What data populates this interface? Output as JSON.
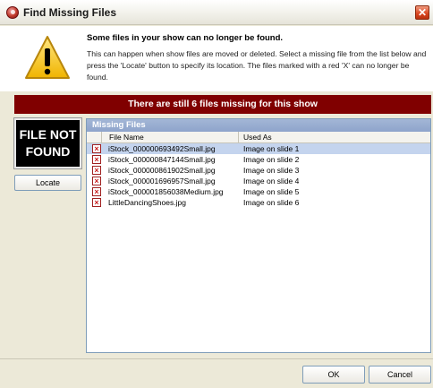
{
  "window": {
    "title": "Find Missing Files",
    "close_glyph": "✕"
  },
  "header": {
    "heading": "Some files in your show can no longer be found.",
    "body": "This can happen when show files are moved or deleted. Select a missing file from the list below and press the 'Locate' button to specify its location. The files marked with a red 'X' can no longer be found.",
    "icon": "warning-icon"
  },
  "banner": {
    "text": "There are still 6 files missing for this show",
    "color": "#800000"
  },
  "preview": {
    "line1": "FILE NOT",
    "line2": "FOUND"
  },
  "locate_button": "Locate",
  "missing_files": {
    "title": "Missing Files",
    "columns": [
      "File Name",
      "Used As"
    ],
    "rows": [
      {
        "file": "iStock_000000693492Small.jpg",
        "used_as": "Image on slide 1",
        "selected": true
      },
      {
        "file": "iStock_000000847144Small.jpg",
        "used_as": "Image on slide 2",
        "selected": false
      },
      {
        "file": "iStock_000000861902Small.jpg",
        "used_as": "Image on slide 3",
        "selected": false
      },
      {
        "file": "iStock_000001696957Small.jpg",
        "used_as": "Image on slide 4",
        "selected": false
      },
      {
        "file": "iStock_000001856038Medium.jpg",
        "used_as": "Image on slide 5",
        "selected": false
      },
      {
        "file": "LittleDancingShoes.jpg",
        "used_as": "Image on slide 6",
        "selected": false
      }
    ]
  },
  "buttons": {
    "ok": "OK",
    "cancel": "Cancel"
  }
}
